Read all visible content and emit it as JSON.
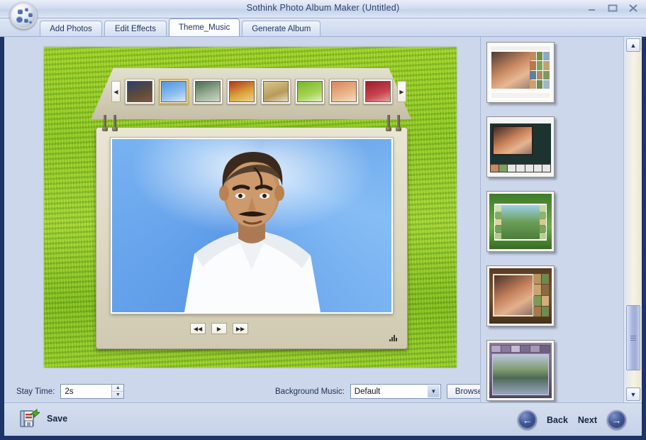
{
  "window": {
    "title": "Sothink Photo Album Maker (Untitled)",
    "logo_name": "app-logo",
    "controls": {
      "minimize": "–",
      "maximize": "❐",
      "close": "✕"
    }
  },
  "tabs": [
    {
      "id": "add-photos",
      "label": "Add Photos",
      "active": false
    },
    {
      "id": "edit-effects",
      "label": "Edit Effects",
      "active": false
    },
    {
      "id": "theme-music",
      "label": "Theme_Music",
      "active": true
    },
    {
      "id": "generate-album",
      "label": "Generate Album",
      "active": false
    }
  ],
  "preview": {
    "thumb_prev": "◀",
    "thumb_next": "▶",
    "thumbnails": [
      {
        "index": 1,
        "selected": false,
        "tint": "#2d3f6b"
      },
      {
        "index": 2,
        "selected": true,
        "tint": "#4f94e0"
      },
      {
        "index": 3,
        "selected": false,
        "tint": "#4a6b52"
      },
      {
        "index": 4,
        "selected": false,
        "tint": "#b2361f"
      },
      {
        "index": 5,
        "selected": false,
        "tint": "#d9c98d"
      },
      {
        "index": 6,
        "selected": false,
        "tint": "#74b52c"
      },
      {
        "index": 7,
        "selected": false,
        "tint": "#d8845c"
      },
      {
        "index": 8,
        "selected": false,
        "tint": "#9b1d2c"
      }
    ],
    "player": {
      "prev_label": "◀◀",
      "play_label": "▶",
      "next_label": "▶▶"
    }
  },
  "options": {
    "stay_time_label": "Stay Time:",
    "stay_time_value": "2s",
    "stay_time_placeholder": "2s",
    "spin_up": "▲",
    "spin_down": "▼",
    "music_label": "Background Music:",
    "music_value": "Default",
    "music_options": [
      "Default"
    ],
    "combo_arrow": "▼",
    "browse_label": "Browse"
  },
  "themes": {
    "scroll_up": "▲",
    "scroll_down": "▼",
    "items": [
      {
        "id": "theme-1",
        "name": "sunset-gallery-theme",
        "selected": false
      },
      {
        "id": "theme-2",
        "name": "sunset-filmstrip-theme",
        "selected": false
      },
      {
        "id": "theme-3",
        "name": "green-nature-theme",
        "selected": false
      },
      {
        "id": "theme-4",
        "name": "wood-frame-theme",
        "selected": false
      },
      {
        "id": "theme-5",
        "name": "lake-purple-theme",
        "selected": false
      }
    ]
  },
  "footer": {
    "save_label": "Save",
    "back_label": "Back",
    "next_label": "Next",
    "back_arrow": "←",
    "next_arrow": "→"
  },
  "colors": {
    "window_chrome": "#1d3466",
    "body_bg": "#ccd7ec",
    "accent": "#3f5596",
    "selection": "#e0b43a"
  }
}
